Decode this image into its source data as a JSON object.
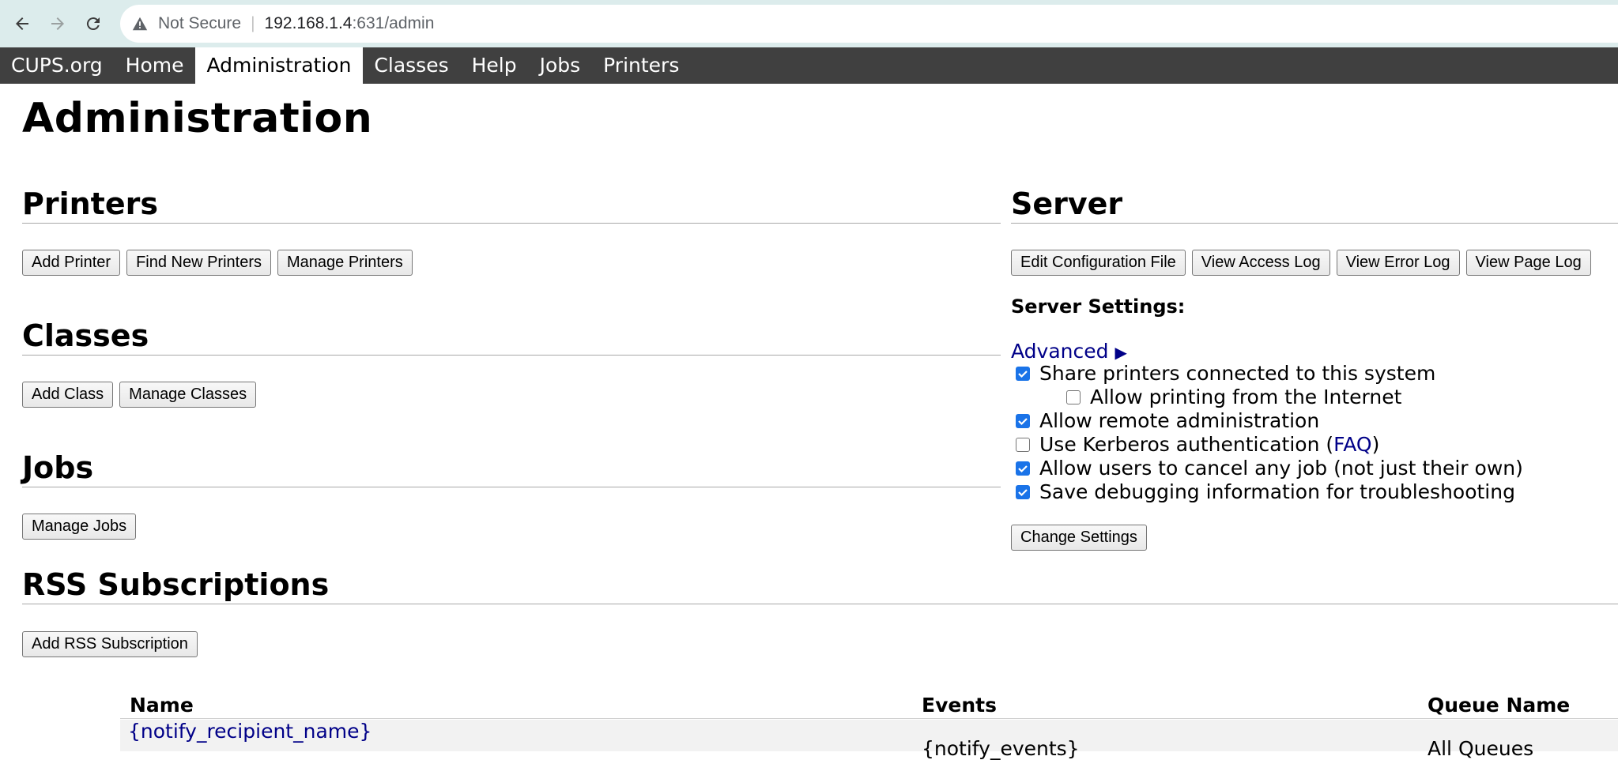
{
  "browser": {
    "security_label": "Not Secure",
    "url_host": "192.168.1.4",
    "url_path": ":631/admin"
  },
  "nav": {
    "items": [
      "CUPS.org",
      "Home",
      "Administration",
      "Classes",
      "Help",
      "Jobs",
      "Printers"
    ],
    "active": "Administration"
  },
  "page": {
    "title": "Administration"
  },
  "printers": {
    "heading": "Printers",
    "buttons": [
      "Add Printer",
      "Find New Printers",
      "Manage Printers"
    ]
  },
  "classes": {
    "heading": "Classes",
    "buttons": [
      "Add Class",
      "Manage Classes"
    ]
  },
  "jobs": {
    "heading": "Jobs",
    "buttons": [
      "Manage Jobs"
    ]
  },
  "server": {
    "heading": "Server",
    "buttons": [
      "Edit Configuration File",
      "View Access Log",
      "View Error Log",
      "View Page Log"
    ],
    "settings_label": "Server Settings:",
    "advanced_label": "Advanced",
    "options": [
      {
        "label": "Share printers connected to this system",
        "checked": true
      },
      {
        "label": "Allow printing from the Internet",
        "checked": false
      },
      {
        "label": "Allow remote administration",
        "checked": true
      },
      {
        "label": "Use Kerberos authentication (",
        "link": "FAQ",
        "suffix": ")",
        "checked": false
      },
      {
        "label": "Allow users to cancel any job (not just their own)",
        "checked": true
      },
      {
        "label": "Save debugging information for troubleshooting",
        "checked": true
      }
    ],
    "change_button": "Change Settings"
  },
  "rss": {
    "heading": "RSS Subscriptions",
    "add_button": "Add RSS Subscription",
    "columns": [
      "Name",
      "Events",
      "Queue Name"
    ],
    "rows": [
      {
        "name": "{notify_recipient_name}",
        "events": "{notify_events}",
        "queue": "All Queues"
      }
    ]
  },
  "colors": {
    "chrome_bg": "#dcecec",
    "nav_bg": "#404040",
    "link": "#000088",
    "checkbox_on": "#1a73e8"
  }
}
